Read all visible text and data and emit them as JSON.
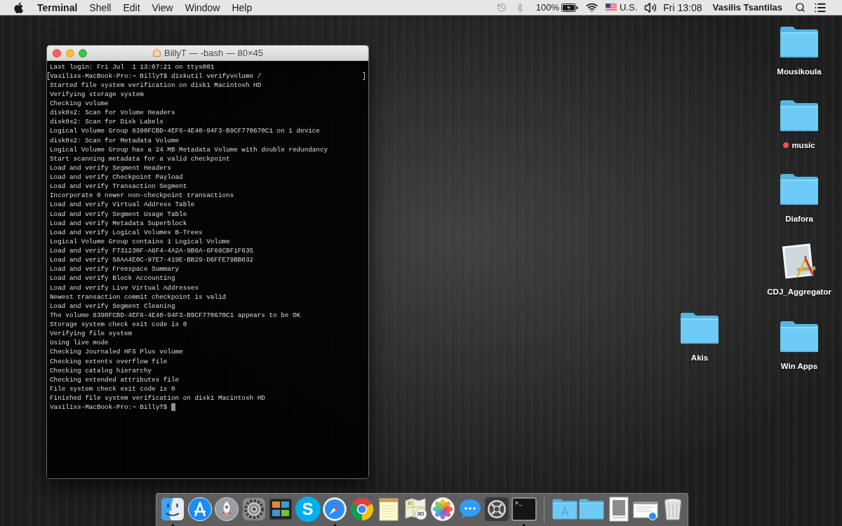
{
  "menu_bar": {
    "menus": [
      {
        "label": "Terminal",
        "kind": "app"
      },
      {
        "label": "Shell",
        "kind": "menu"
      },
      {
        "label": "Edit",
        "kind": "menu"
      },
      {
        "label": "View",
        "kind": "menu"
      },
      {
        "label": "Window",
        "kind": "menu"
      },
      {
        "label": "Help",
        "kind": "menu"
      }
    ],
    "status": {
      "bluetooth_on": false,
      "battery": "100%",
      "charging": true,
      "input_source": "U.S.",
      "clock": "Fri 13:08",
      "user": "Vasilis Tsantilas"
    }
  },
  "terminal": {
    "title": "BillyT — -bash — 80×45",
    "lines": [
      {
        "text": "Last login: Fri Jul  1 13:07:21 on ttys001",
        "marked": false
      },
      {
        "text": "Vasiliss-MacBook-Pro:~ BillyT$ diskutil verifyvolume /",
        "marked": true
      },
      {
        "text": "Started file system verification on disk1 Macintosh HD",
        "marked": false
      },
      {
        "text": "Verifying storage system",
        "marked": false
      },
      {
        "text": "Checking volume",
        "marked": false
      },
      {
        "text": "disk0s2: Scan for Volume Headers",
        "marked": false
      },
      {
        "text": "disk0s2: Scan for Disk Labels",
        "marked": false
      },
      {
        "text": "Logical Volume Group 8390FCBD-4EF6-4E40-94F3-B9CF770670C1 on 1 device",
        "marked": false
      },
      {
        "text": "disk0s2: Scan for Metadata Volume",
        "marked": false
      },
      {
        "text": "Logical Volume Group has a 24 MB Metadata Volume with double redundancy",
        "marked": false
      },
      {
        "text": "Start scanning metadata for a valid checkpoint",
        "marked": false
      },
      {
        "text": "Load and verify Segment Headers",
        "marked": false
      },
      {
        "text": "Load and verify Checkpoint Payload",
        "marked": false
      },
      {
        "text": "Load and verify Transaction Segment",
        "marked": false
      },
      {
        "text": "Incorporate 0 newer non-checkpoint transactions",
        "marked": false
      },
      {
        "text": "Load and verify Virtual Address Table",
        "marked": false
      },
      {
        "text": "Load and verify Segment Usage Table",
        "marked": false
      },
      {
        "text": "Load and verify Metadata Superblock",
        "marked": false
      },
      {
        "text": "Load and verify Logical Volumes B-Trees",
        "marked": false
      },
      {
        "text": "Logical Volume Group contains 1 Logical Volume",
        "marked": false
      },
      {
        "text": "Load and verify F731230F-A8F4-4A2A-9B6A-6F68CBF1F635",
        "marked": false
      },
      {
        "text": "Load and verify 58AA4E0C-97E7-419E-BB29-D6FFE79BB032",
        "marked": false
      },
      {
        "text": "Load and verify Freespace Summary",
        "marked": false
      },
      {
        "text": "Load and verify Block Accounting",
        "marked": false
      },
      {
        "text": "Load and verify Live Virtual Addresses",
        "marked": false
      },
      {
        "text": "Newest transaction commit checkpoint is valid",
        "marked": false
      },
      {
        "text": "Load and verify Segment Cleaning",
        "marked": false
      },
      {
        "text": "The volume 8390FCBD-4EF6-4E40-94F3-B9CF770670C1 appears to be OK",
        "marked": false
      },
      {
        "text": "Storage system check exit code is 0",
        "marked": false
      },
      {
        "text": "Verifying file system",
        "marked": false
      },
      {
        "text": "Using live mode",
        "marked": false
      },
      {
        "text": "Checking Journaled HFS Plus volume",
        "marked": false
      },
      {
        "text": "Checking extents overflow file",
        "marked": false
      },
      {
        "text": "Checking catalog hierarchy",
        "marked": false
      },
      {
        "text": "Checking extended attributes file",
        "marked": false
      },
      {
        "text": "File system check exit code is 0",
        "marked": false
      },
      {
        "text": "Finished file system verification on disk1 Macintosh HD",
        "marked": false
      }
    ],
    "prompt": {
      "text": "Vasiliss-MacBook-Pro:~ BillyT$",
      "cursor": true
    }
  },
  "desktop": {
    "items": [
      {
        "kind": "folder",
        "label": "Mousikoula"
      },
      {
        "kind": "folder",
        "label": "music",
        "color": "#f24e4b"
      },
      {
        "kind": "folder",
        "label": "Diafora"
      },
      {
        "kind": "app",
        "label": "CDJ_Aggregator"
      },
      {
        "kind": "folder",
        "label": "Akis"
      },
      {
        "kind": "folder",
        "label": "Win Apps"
      }
    ]
  },
  "dock": {
    "apps": [
      {
        "kind": "face",
        "running": true
      },
      {
        "kind": "drafting",
        "running": false
      },
      {
        "kind": "rocket",
        "running": false
      },
      {
        "kind": "gear",
        "running": false
      },
      {
        "kind": "tiles",
        "running": false
      },
      {
        "kind": "letter",
        "glyph": "S",
        "running": false
      },
      {
        "kind": "compass",
        "running": true
      },
      {
        "kind": "segments",
        "running": false
      },
      {
        "kind": "notepad",
        "running": false
      },
      {
        "kind": "map",
        "glyph": "3D",
        "running": false
      },
      {
        "kind": "flower",
        "running": false
      },
      {
        "kind": "bubble",
        "running": false
      },
      {
        "kind": "crossed",
        "running": false
      },
      {
        "kind": "console",
        "glyph": ">_",
        "running": true
      }
    ],
    "stacks": [
      {
        "kind": "appfolder"
      },
      {
        "kind": "folder"
      },
      {
        "kind": "document"
      },
      {
        "kind": "webpage"
      },
      {
        "kind": "trash"
      }
    ]
  }
}
